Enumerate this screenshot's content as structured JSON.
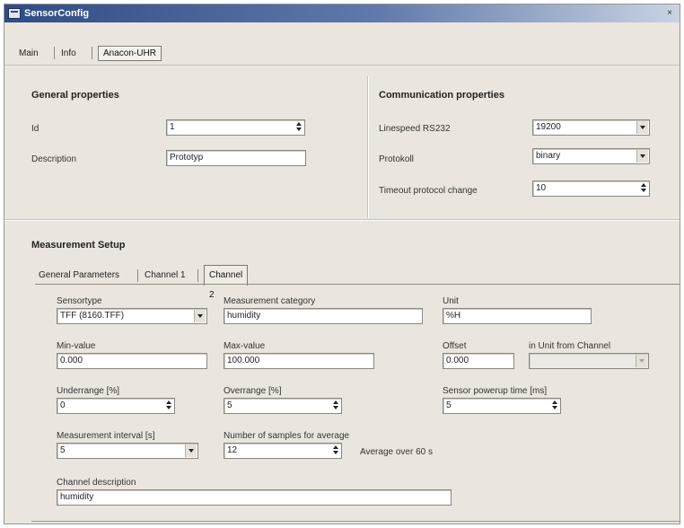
{
  "window": {
    "title": "SensorConfig",
    "close_symbol": "×"
  },
  "tabs": [
    "Main",
    "Info",
    "Anacon-UHR"
  ],
  "general": {
    "heading": "General properties",
    "id_label": "Id",
    "id_value": "1",
    "desc_label": "Description",
    "desc_value": "Prototyp"
  },
  "comm": {
    "heading": "Communication properties",
    "linespeed_label": "Linespeed RS232",
    "linespeed_value": "19200",
    "protocol_label": "Protokoll",
    "protocol_value": "binary",
    "timeout_label": "Timeout protocol change",
    "timeout_value": "10"
  },
  "measurement": {
    "heading": "Measurement Setup",
    "subtabs": [
      "General Parameters",
      "Channel 1",
      "Channel 2"
    ],
    "fields": {
      "sensortype_label": "Sensortype",
      "sensortype_value": "TFF (8160.TFF)",
      "category_label": "Measurement category",
      "category_value": "humidity",
      "unit_label": "Unit",
      "unit_value": "%H",
      "min_label": "Min-value",
      "min_value": "0.000",
      "max_label": "Max-value",
      "max_value": "100.000",
      "offset_label": "Offset",
      "offset_value": "0.000",
      "unit_from_channel_label": "in Unit from Channel",
      "unit_from_channel_value": "",
      "underrange_label": "Underrange [%]",
      "underrange_value": "0",
      "overrange_label": "Overrange [%]",
      "overrange_value": "5",
      "powerup_label": "Sensor powerup time [ms]",
      "powerup_value": "5",
      "interval_label": "Measurement interval [s]",
      "interval_value": "5",
      "samples_label": "Number of samples for average",
      "samples_value": "12",
      "average_text": "Average over 60 s",
      "channel_desc_label": "Channel description",
      "channel_desc_value": "humidity"
    }
  }
}
